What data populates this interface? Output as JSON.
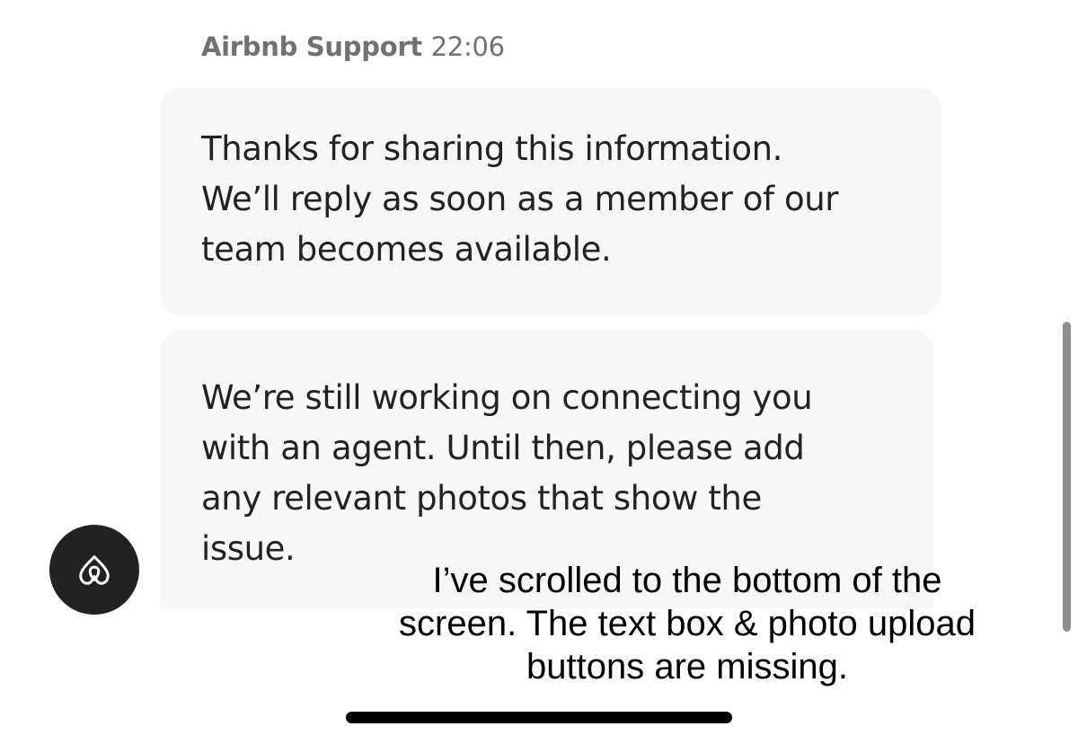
{
  "conversation": {
    "sender": "Airbnb Support",
    "time": "22:06",
    "messages": [
      {
        "text": "Thanks for sharing this information.\nWe’ll reply as soon as a member of our\nteam becomes available."
      },
      {
        "text": "We’re still working on connecting you\nwith an agent. Until then, please add\nany relevant photos that show the\nissue."
      }
    ],
    "avatar_icon": "airbnb-logo-icon"
  },
  "annotation": {
    "text": "I’ve scrolled to the bottom of the\nscreen. The text box & photo upload\nbuttons are missing."
  },
  "colors": {
    "bubble_background": "#f7f7f7",
    "sender_text": "#717171",
    "avatar_background": "#222222",
    "message_text": "#222222"
  }
}
